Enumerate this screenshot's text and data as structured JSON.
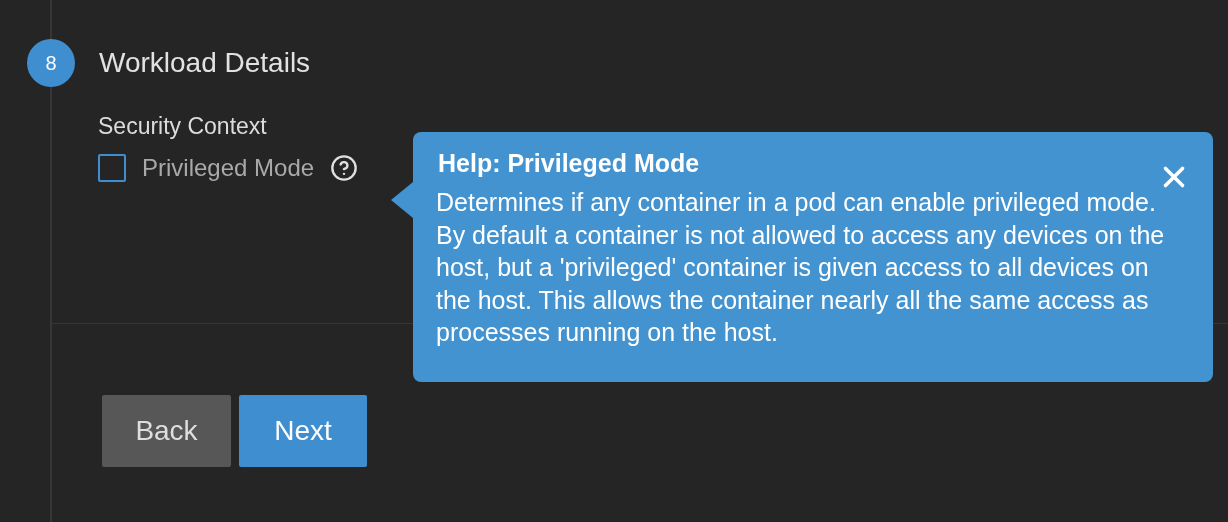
{
  "step": {
    "number": "8",
    "title": "Workload Details"
  },
  "section": {
    "label": "Security Context",
    "checkbox": {
      "label": "Privileged Mode",
      "checked": false
    }
  },
  "help": {
    "title": "Help: Privileged Mode",
    "body": "Determines if any container in a pod can enable privileged mode. By default a container is not allowed to access any devices on the host, but a 'privileged' container is given access to all devices on the host. This allows the container nearly all the same access as processes running on the host."
  },
  "buttons": [
    {
      "label": "Back",
      "kind": "secondary"
    },
    {
      "label": "Next",
      "kind": "primary"
    }
  ]
}
